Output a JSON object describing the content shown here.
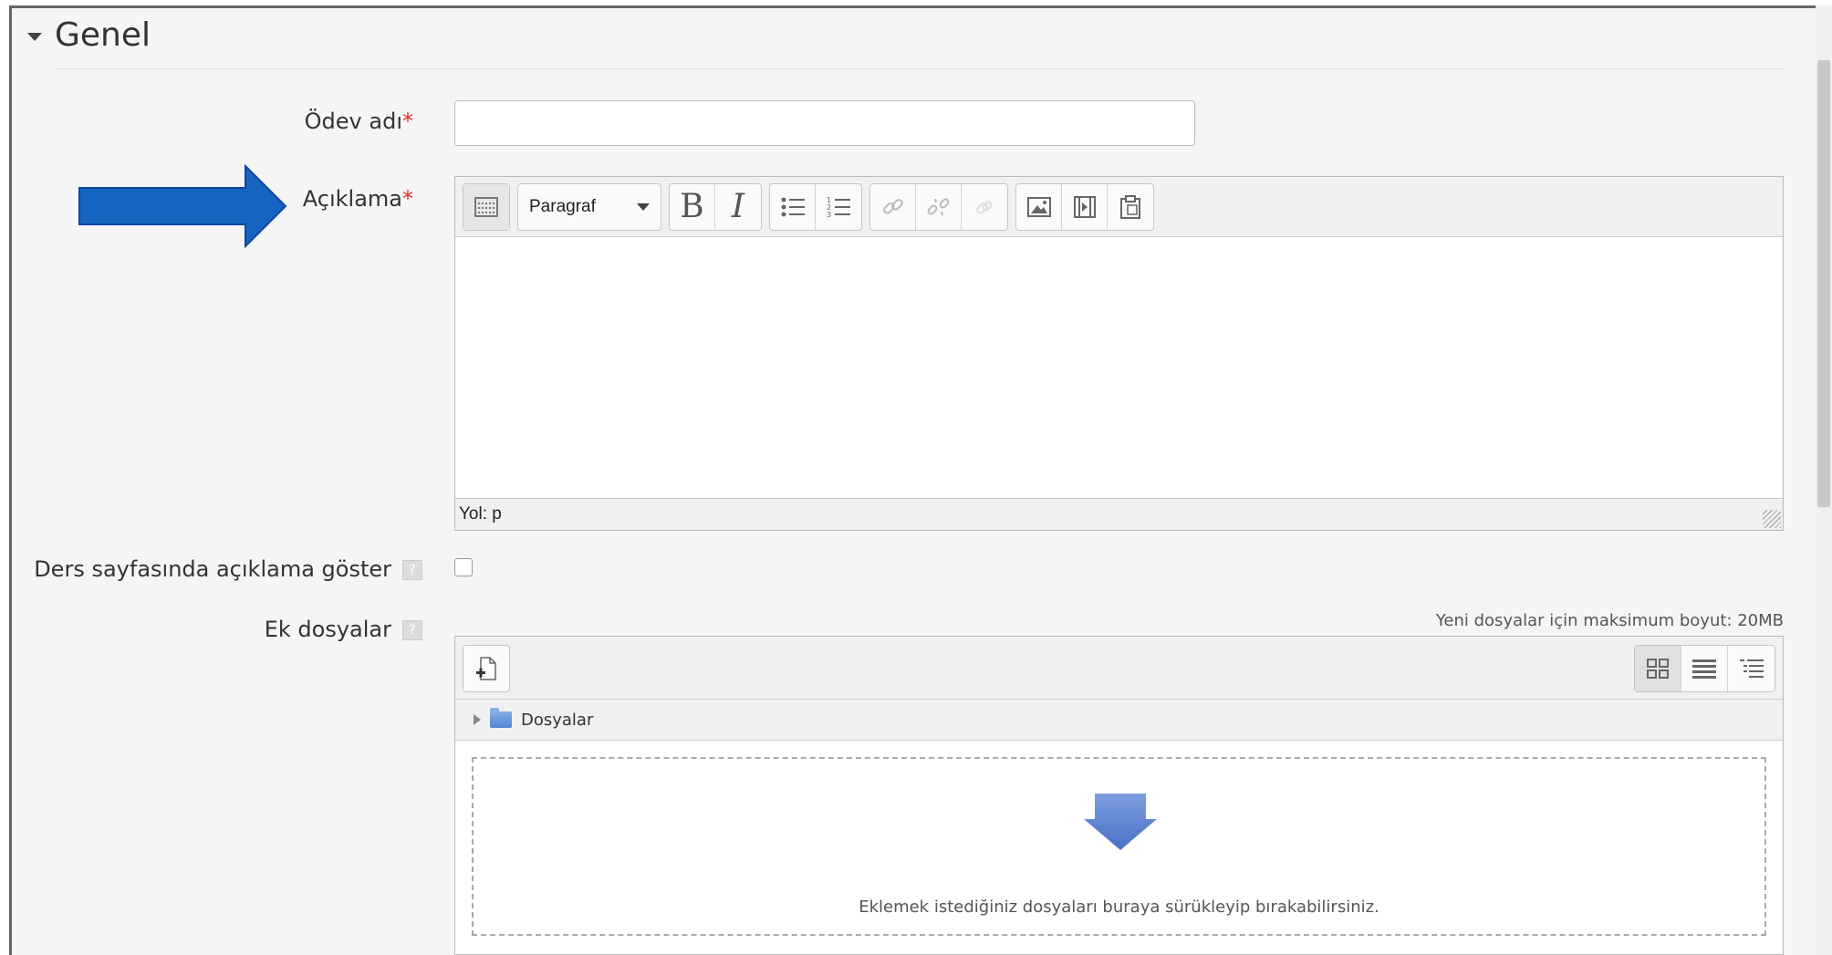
{
  "section": {
    "title": "Genel"
  },
  "fields": {
    "assignment_name": {
      "label": "Ödev adı",
      "required_mark": "*",
      "value": ""
    },
    "description": {
      "label": "Açıklama",
      "required_mark": "*"
    },
    "show_description": {
      "label": "Ders sayfasında açıklama göster",
      "help": "?",
      "checked": false
    },
    "attachments": {
      "label": "Ek dosyalar",
      "help": "?"
    }
  },
  "editor": {
    "paragraph_select": "Paragraf",
    "bold": "B",
    "italic": "I",
    "status_path": "Yol: p",
    "icons": [
      "toolbar-toggle-icon",
      "bold-icon",
      "italic-icon",
      "bullet-list-icon",
      "numbered-list-icon",
      "link-icon",
      "unlink-icon",
      "anchor-icon",
      "image-icon",
      "media-icon",
      "paste-icon"
    ]
  },
  "filemanager": {
    "max_size": "Yeni dosyalar için maksimum boyut: 20MB",
    "folder_label": "Dosyalar",
    "drop_text": "Eklemek istediğiniz dosyaları buraya sürükleyip bırakabilirsiniz.",
    "views": [
      "icons-view-icon",
      "list-view-icon",
      "tree-view-icon"
    ]
  },
  "colors": {
    "required": "#d9312b",
    "annotation_arrow": "#1565c0",
    "drop_arrow": "#5b82cf"
  }
}
